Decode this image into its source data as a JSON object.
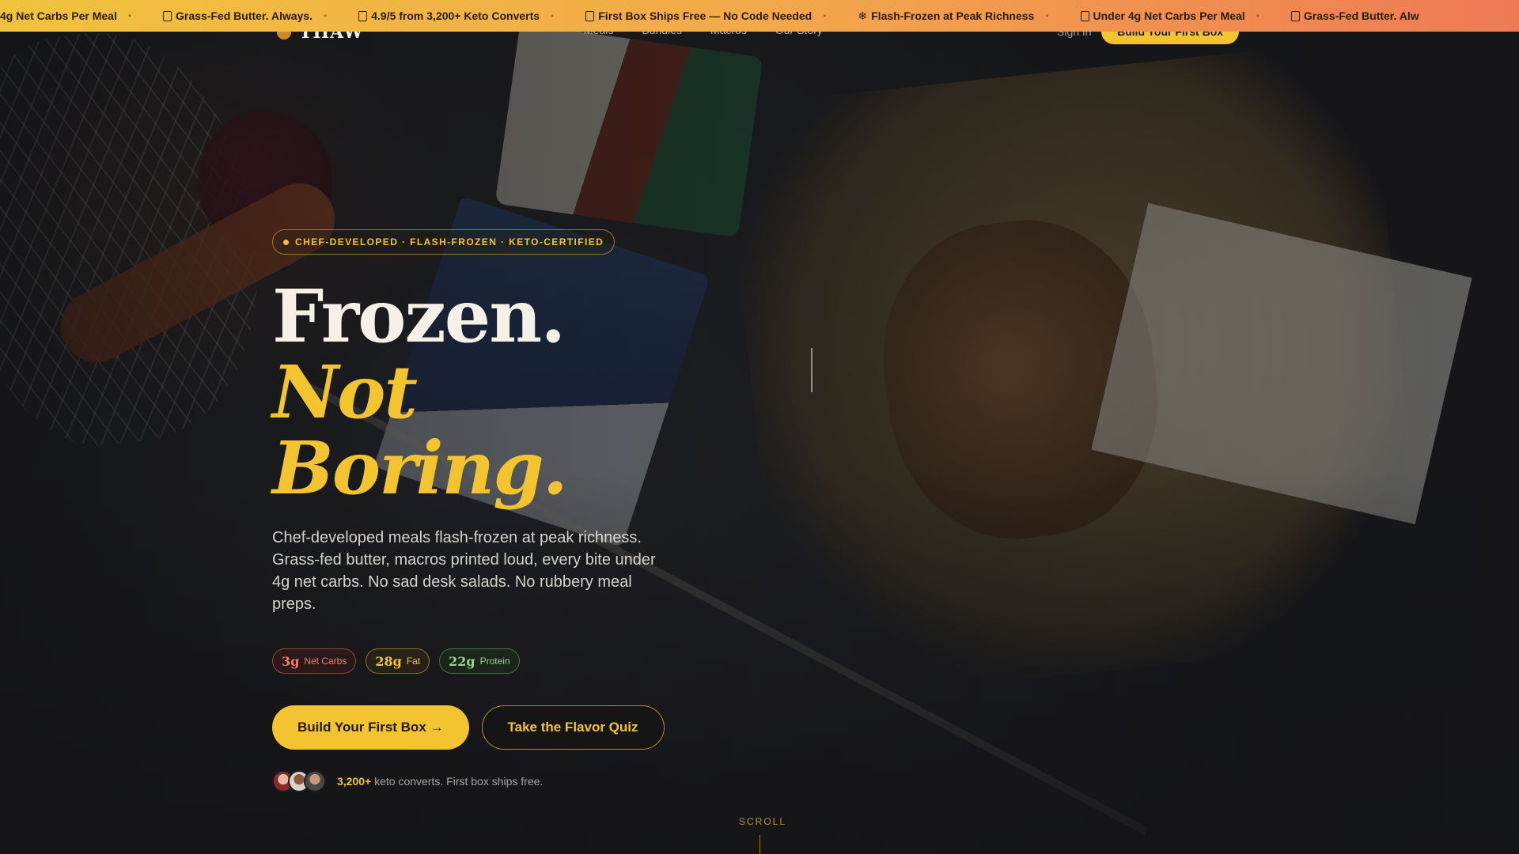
{
  "ticker": {
    "items": [
      {
        "text": "4g Net Carbs Per Meal",
        "icon": "box-icon"
      },
      {
        "text": "Grass-Fed Butter. Always.",
        "icon": "box-icon"
      },
      {
        "text": "4.9/5 from 3,200+ Keto Converts",
        "icon": "box-icon"
      },
      {
        "text": "First Box Ships Free — No Code Needed",
        "icon": "box-icon"
      },
      {
        "text": "Flash-Frozen at Peak Richness",
        "icon": "snowflake-icon"
      },
      {
        "text": "Under 4g Net Carbs Per Meal",
        "icon": "box-icon"
      },
      {
        "text": "Grass-Fed Butter. Alw",
        "icon": "box-icon"
      }
    ],
    "separator": "•",
    "colors": {
      "start": "#f1c23c",
      "end": "#ee7a55"
    }
  },
  "nav": {
    "brand": "THAW",
    "links": [
      "Meals",
      "Bundles",
      "Macros",
      "Our Story"
    ],
    "signin": "Sign In",
    "cta": "Build Your First Box"
  },
  "hero": {
    "badge": "CHEF-DEVELOPED · FLASH-FROZEN · KETO-CERTIFIED",
    "headline_line1": "Frozen.",
    "headline_line2": "Not Boring.",
    "subcopy": "Chef-developed meals flash-frozen at peak richness. Grass-fed butter, macros printed loud, every bite under 4g net carbs. No sad desk salads. No rubbery meal preps.",
    "macros": [
      {
        "value": "3g",
        "label": "Net Carbs",
        "color": "#ef7f6c"
      },
      {
        "value": "28g",
        "label": "Fat",
        "color": "#f4c430"
      },
      {
        "value": "22g",
        "label": "Protein",
        "color": "#9fd38c"
      }
    ],
    "primary_cta": "Build Your First Box →",
    "secondary_cta": "Take the Flavor Quiz",
    "proof_count": "3,200+",
    "proof_text": "keto converts. First box ships free."
  },
  "scroll": {
    "label": "SCROLL"
  },
  "colors": {
    "accent": "#f4c430",
    "background": "#1b1c1f",
    "text": "#f3efe6"
  }
}
